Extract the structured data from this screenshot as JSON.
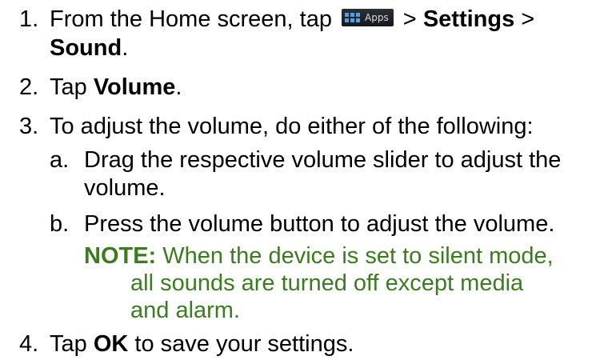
{
  "steps": [
    {
      "number": "1.",
      "text_before_icon": "From the Home screen, tap",
      "icon_label": "Apps",
      "text_after_icon": " > ",
      "bold_1": "Settings",
      "sep": " >",
      "bold_2": "Sound",
      "end": "."
    },
    {
      "number": "2.",
      "text": "Tap ",
      "bold": "Volume",
      "end": "."
    },
    {
      "number": "3.",
      "text": "To adjust the volume, do either of the following:",
      "substeps": [
        {
          "letter": "a.",
          "line1": "Drag the respective volume slider to adjust the",
          "line2": "volume."
        },
        {
          "letter": "b.",
          "text": "Press the volume button to adjust the volume."
        }
      ],
      "note": {
        "label": "NOTE:",
        "line1": " When the device is set to silent mode,",
        "line2": "all sounds are turned off except media",
        "line3": "and alarm."
      }
    },
    {
      "number": "4.",
      "text": "Tap ",
      "bold": "OK",
      "end": " to save your settings."
    }
  ],
  "colors": {
    "text": "#000000",
    "note": "#3a7d1e",
    "apps_icon": "#4aa3e8"
  }
}
